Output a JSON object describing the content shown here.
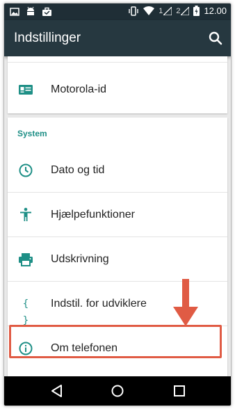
{
  "status_bar": {
    "sim1": "1",
    "sim2": "2",
    "time": "12.00",
    "icons": [
      "image-notification-icon",
      "android-notification-icon",
      "briefcase-notification-icon",
      "vibrate-icon",
      "wifi-icon",
      "signal-icon",
      "signal-icon",
      "battery-charging-icon"
    ]
  },
  "app_bar": {
    "title": "Indstillinger",
    "search_icon": "search-icon"
  },
  "items_top": [
    {
      "label": "Motorola-id",
      "icon": "id-card-icon"
    }
  ],
  "section": {
    "header": "System",
    "items": [
      {
        "label": "Dato og tid",
        "icon": "clock-icon"
      },
      {
        "label": "Hjælpefunktioner",
        "icon": "accessibility-icon"
      },
      {
        "label": "Udskrivning",
        "icon": "printer-icon"
      },
      {
        "label": "Indstil. for udviklere",
        "icon": "braces-icon",
        "glyph": "{ }"
      },
      {
        "label": "Om telefonen",
        "icon": "info-icon"
      }
    ]
  },
  "colors": {
    "accent": "#1e8f86",
    "app_bar": "#263840",
    "status_bar": "#1f2e36",
    "annotation": "#e05b44"
  },
  "nav_bar": {
    "icons": [
      "back-icon",
      "home-icon",
      "recents-icon"
    ]
  }
}
